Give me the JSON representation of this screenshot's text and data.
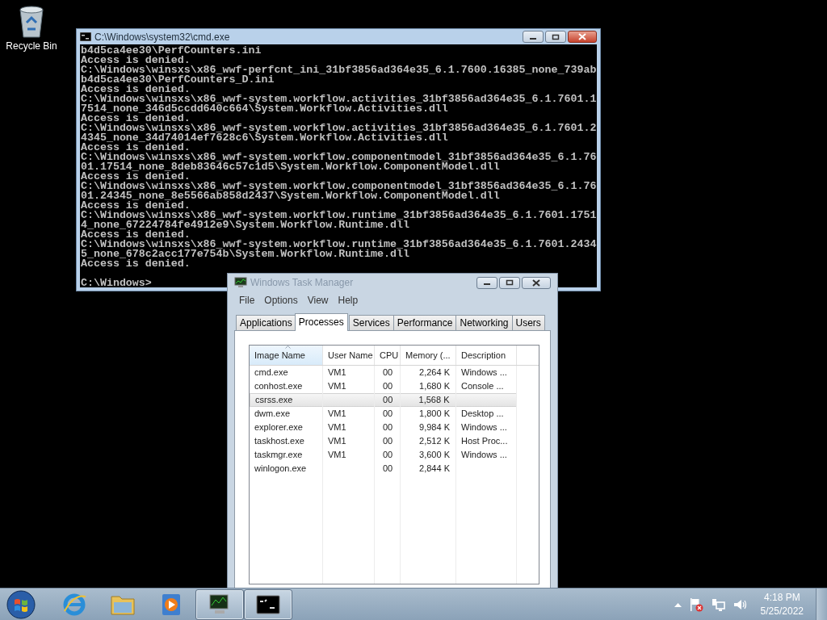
{
  "desktop_icons": [
    {
      "label": "Recycle Bin"
    }
  ],
  "console": {
    "title": "C:\\Windows\\system32\\cmd.exe",
    "lines": [
      "b4d5ca4ee30\\PerfCounters.ini",
      "Access is denied.",
      "C:\\Windows\\winsxs\\x86_wwf-perfcnt_ini_31bf3856ad364e35_6.1.7600.16385_none_739ab",
      "b4d5ca4ee30\\PerfCounters_D.ini",
      "Access is denied.",
      "C:\\Windows\\winsxs\\x86_wwf-system.workflow.activities_31bf3856ad364e35_6.1.7601.1",
      "7514_none_346d5ccdd640c664\\System.Workflow.Activities.dll",
      "Access is denied.",
      "C:\\Windows\\winsxs\\x86_wwf-system.workflow.activities_31bf3856ad364e35_6.1.7601.2",
      "4345_none_34d74014ef7628c6\\System.Workflow.Activities.dll",
      "Access is denied.",
      "C:\\Windows\\winsxs\\x86_wwf-system.workflow.componentmodel_31bf3856ad364e35_6.1.76",
      "01.17514_none_8deb83646c57c1d5\\System.Workflow.ComponentModel.dll",
      "Access is denied.",
      "C:\\Windows\\winsxs\\x86_wwf-system.workflow.componentmodel_31bf3856ad364e35_6.1.76",
      "01.24345_none_8e5566ab858d2437\\System.Workflow.ComponentModel.dll",
      "Access is denied.",
      "C:\\Windows\\winsxs\\x86_wwf-system.workflow.runtime_31bf3856ad364e35_6.1.7601.1751",
      "4_none_67224784fe4912e9\\System.Workflow.Runtime.dll",
      "Access is denied.",
      "C:\\Windows\\winsxs\\x86_wwf-system.workflow.runtime_31bf3856ad364e35_6.1.7601.2434",
      "5_none_678c2acc177e754b\\System.Workflow.Runtime.dll",
      "Access is denied."
    ],
    "prompt": "C:\\Windows>"
  },
  "task_manager": {
    "title": "Windows Task Manager",
    "menu": [
      "File",
      "Options",
      "View",
      "Help"
    ],
    "tabs": [
      {
        "label": "Applications",
        "selected": false
      },
      {
        "label": "Processes",
        "selected": true
      },
      {
        "label": "Services",
        "selected": false
      },
      {
        "label": "Performance",
        "selected": false
      },
      {
        "label": "Networking",
        "selected": false
      },
      {
        "label": "Users",
        "selected": false
      }
    ],
    "columns": [
      "Image Name",
      "User Name",
      "CPU",
      "Memory (...",
      "Description"
    ],
    "rows": [
      {
        "cells": [
          "cmd.exe",
          "VM1",
          "00",
          "2,264 K",
          "Windows ..."
        ],
        "selected": false
      },
      {
        "cells": [
          "conhost.exe",
          "VM1",
          "00",
          "1,680 K",
          "Console ..."
        ],
        "selected": false
      },
      {
        "cells": [
          "csrss.exe",
          "",
          "00",
          "1,568 K",
          ""
        ],
        "selected": true
      },
      {
        "cells": [
          "dwm.exe",
          "VM1",
          "00",
          "1,800 K",
          "Desktop ..."
        ],
        "selected": false
      },
      {
        "cells": [
          "explorer.exe",
          "VM1",
          "00",
          "9,984 K",
          "Windows ..."
        ],
        "selected": false
      },
      {
        "cells": [
          "taskhost.exe",
          "VM1",
          "00",
          "2,512 K",
          "Host Proc..."
        ],
        "selected": false
      },
      {
        "cells": [
          "taskmgr.exe",
          "VM1",
          "00",
          "3,600 K",
          "Windows ..."
        ],
        "selected": false
      },
      {
        "cells": [
          "winlogon.exe",
          "",
          "00",
          "2,844 K",
          ""
        ],
        "selected": false
      }
    ]
  },
  "taskbar": {
    "apps": [
      {
        "kind": "browser",
        "running": false
      },
      {
        "kind": "folder",
        "running": false
      },
      {
        "kind": "media",
        "running": false
      },
      {
        "kind": "taskmgr",
        "running": true
      },
      {
        "kind": "console",
        "running": true
      }
    ],
    "clock": {
      "time": "4:18 PM",
      "date": "5/25/2022"
    }
  }
}
